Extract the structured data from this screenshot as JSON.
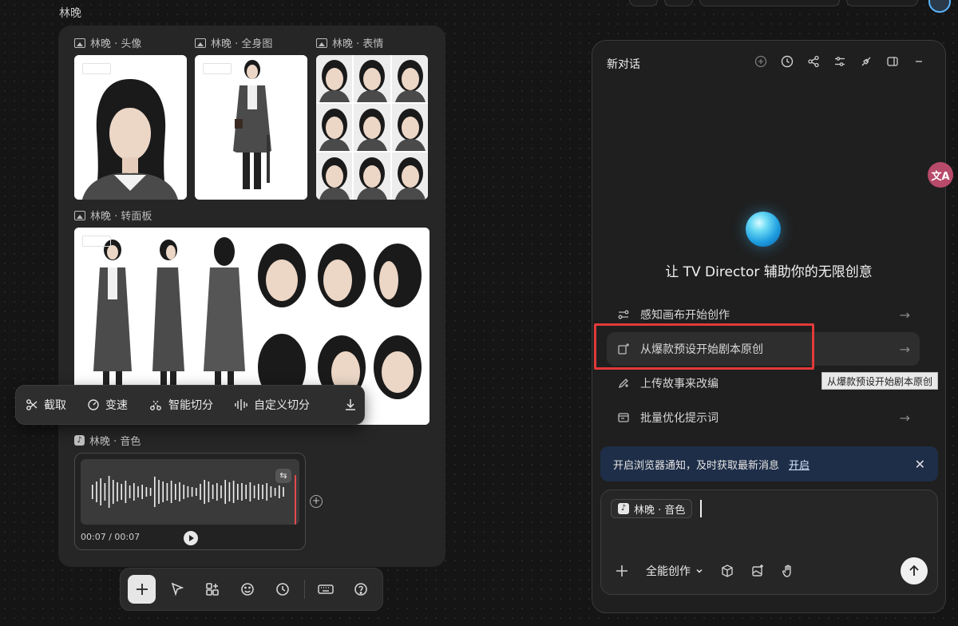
{
  "group": {
    "title": "林晚"
  },
  "canvas": {
    "assets": {
      "portrait_label": "林晚 · 头像",
      "fullbody_label": "林晚 · 全身图",
      "expression_label": "林晚 · 表情",
      "turnaround_label": "林晚 · 转面板",
      "voice_label": "林晚 · 音色"
    },
    "media_toolbar": {
      "crop": "截取",
      "speed": "变速",
      "smart_split": "智能切分",
      "custom_split": "自定义切分"
    },
    "audio": {
      "time": "00:07 / 00:07"
    }
  },
  "chat": {
    "title": "新对话",
    "hero": "让 TV Director 辅助你的无限创意",
    "actions": [
      {
        "label": "感知画布开始创作",
        "icon": "canvas-sense-icon"
      },
      {
        "label": "从爆款预设开始剧本原创",
        "icon": "preset-script-icon"
      },
      {
        "label": "上传故事来改编",
        "icon": "upload-story-icon"
      },
      {
        "label": "批量优化提示词",
        "icon": "batch-prompt-icon"
      }
    ],
    "tooltip": "从爆款预设开始剧本原创",
    "notice": {
      "text": "开启浏览器通知，及时获取最新消息",
      "link": "开启"
    },
    "composer": {
      "chip": "林晚 · 音色",
      "mode": "全能创作"
    }
  },
  "icons": {
    "header": [
      "add-chat-icon",
      "history-icon",
      "share-icon",
      "settings-icon",
      "connect-icon",
      "panel-icon",
      "minimize-icon"
    ],
    "bottom_toolbar": [
      "plus-icon",
      "pointer-icon",
      "apps-icon",
      "emoji-icon",
      "clock-icon",
      "keyboard-icon",
      "help-icon"
    ],
    "side": "translate-icon"
  },
  "colors": {
    "accent_blue": "#1e9ee0",
    "highlight_red": "#e23a3a",
    "notice_bg": "#1e2e48",
    "panel_bg": "#1f1f1f"
  }
}
